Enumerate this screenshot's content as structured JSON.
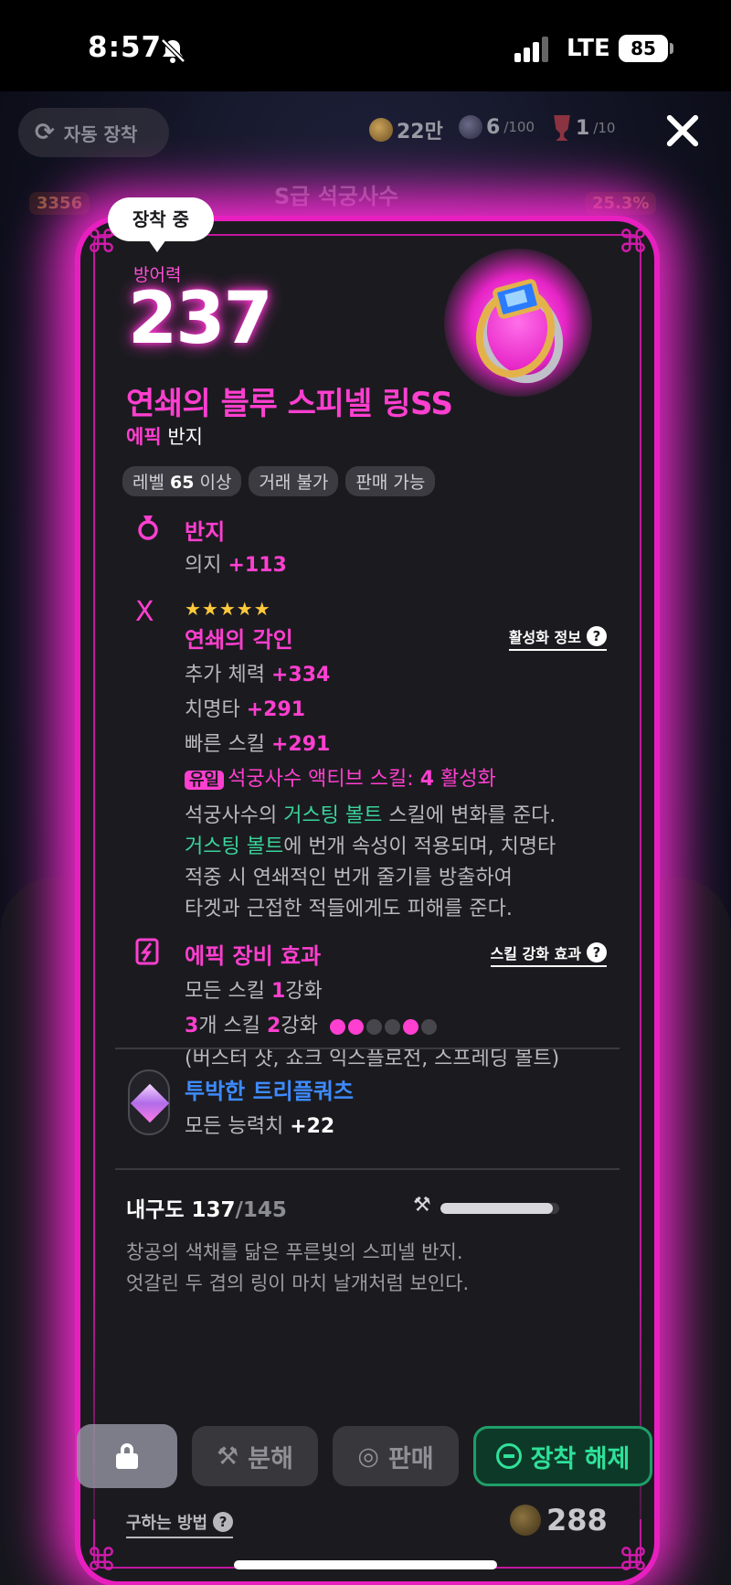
{
  "status_bar": {
    "time": "8:57",
    "network": "LTE",
    "battery": "85"
  },
  "header": {
    "auto_equip_label": "자동 장착",
    "gold": "22만",
    "orbs": "6",
    "orbs_max": "/100",
    "trophy": "1",
    "trophy_max": "/10"
  },
  "background": {
    "title": "S급 석궁사수",
    "chip_1": "3356",
    "chip_2": "25.3%"
  },
  "equipped_tag": "장착 중",
  "item": {
    "stat_label": "방어력",
    "stat_value": "237",
    "name": "연쇄의 블루 스피넬 링SS",
    "rarity": "에픽",
    "type": "반지",
    "chips": {
      "level_prefix": "레벨 ",
      "level_value": "65",
      "level_suffix": " 이상",
      "trade": "거래 불가",
      "sell": "판매 가능"
    }
  },
  "section_ring": {
    "title": "반지",
    "stat_name": "의지 ",
    "stat_value": "+113"
  },
  "section_engrave": {
    "stars": "★★★★★",
    "title": "연쇄의 각인",
    "info_link": "활성화 정보",
    "stats": [
      {
        "name": "추가 체력 ",
        "value": "+334"
      },
      {
        "name": "치명타 ",
        "value": "+291"
      },
      {
        "name": "빠른 스킬 ",
        "value": "+291"
      }
    ],
    "unique_badge": "유일",
    "unique_text_a": "석궁사수 액티브 스킬: ",
    "unique_value": "4",
    "unique_text_b": " 활성화",
    "desc_1a": "석궁사수의 ",
    "desc_1b": "거스팅 볼트",
    "desc_1c": " 스킬에 변화를 준다.",
    "desc_2a": "거스팅 볼트",
    "desc_2b": "에 번개 속성이 적용되며, 치명타",
    "desc_3": "적중 시 연쇄적인 번개 줄기를 방출하여",
    "desc_4": "타겟과 근접한 적들에게도 피해를 준다."
  },
  "section_epic": {
    "title": "에픽 장비 효과",
    "info_link": "스킬 강화 효과",
    "line1_a": "모든 스킬 ",
    "line1_b": "1",
    "line1_c": "강화",
    "line2_a": "3",
    "line2_b": "개 스킬 ",
    "line2_c": "2",
    "line2_d": "강화",
    "line3": "(버스터 샷, 쇼크 익스플로전, 스프레딩 볼트)"
  },
  "gem": {
    "name": "투박한 트리플쿼츠",
    "stat_name": "모든 능력치 ",
    "stat_value": "+22"
  },
  "durability": {
    "label": "내구도 ",
    "current": "137",
    "max": "/145",
    "fraction": 0.945
  },
  "description": {
    "line1": "창공의 색채를 닮은 푸른빛의 스피넬 반지.",
    "line2": "엇갈린 두 겹의 링이 마치 날개처럼 보인다."
  },
  "howto_label": "구하는 방법",
  "price": "288",
  "actions": {
    "disassemble": "분해",
    "sell": "판매",
    "unequip": "장착 해제"
  },
  "colors": {
    "accent": "#ff3fd0",
    "glow": "#ff2bd6",
    "unequip": "#2fe19a",
    "gem_title": "#3e8bff",
    "highlight_green": "#3ad39a"
  }
}
